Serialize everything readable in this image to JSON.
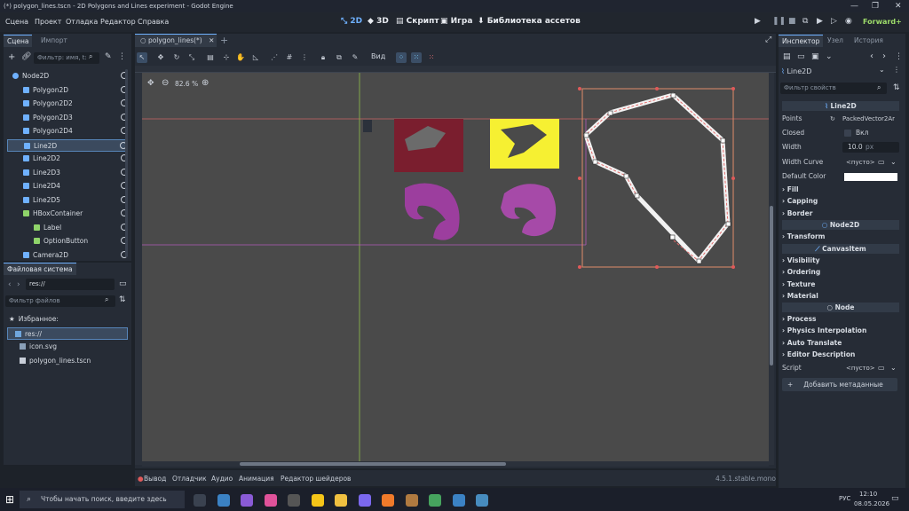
{
  "window": {
    "title": "(*) polygon_lines.tscn - 2D Polygons and Lines experiment - Godot Engine",
    "controls": [
      "—",
      "❐",
      "✕"
    ]
  },
  "menu": [
    "Сцена",
    "Проект",
    "Отладка",
    "Редактор",
    "Справка"
  ],
  "workspaces": [
    {
      "label": "2D",
      "active": true
    },
    {
      "label": "3D",
      "active": false
    },
    {
      "label": "Скрипт",
      "active": false
    },
    {
      "label": "Игра",
      "active": false
    },
    {
      "label": "Библиотека ассетов",
      "active": false
    }
  ],
  "renderer": "Forward+",
  "scene_dock": {
    "tabs": [
      "Сцена",
      "Импорт"
    ],
    "filter_placeholder": "Фильтр: имя, t:",
    "nodes": [
      {
        "label": "Node2D",
        "depth": 0,
        "icon": "node2d-icon"
      },
      {
        "label": "Polygon2D",
        "depth": 1,
        "icon": "polygon-icon"
      },
      {
        "label": "Polygon2D2",
        "depth": 1,
        "icon": "polygon-icon"
      },
      {
        "label": "Polygon2D3",
        "depth": 1,
        "icon": "polygon-icon"
      },
      {
        "label": "Polygon2D4",
        "depth": 1,
        "icon": "polygon-icon"
      },
      {
        "label": "Line2D",
        "depth": 1,
        "icon": "line-icon",
        "selected": true
      },
      {
        "label": "Line2D2",
        "depth": 1,
        "icon": "line-icon"
      },
      {
        "label": "Line2D3",
        "depth": 1,
        "icon": "line-icon"
      },
      {
        "label": "Line2D4",
        "depth": 1,
        "icon": "line-icon"
      },
      {
        "label": "Line2D5",
        "depth": 1,
        "icon": "line-icon"
      },
      {
        "label": "HBoxContainer",
        "depth": 1,
        "icon": "hbox-icon"
      },
      {
        "label": "Label",
        "depth": 2,
        "icon": "label-icon"
      },
      {
        "label": "OptionButton",
        "depth": 2,
        "icon": "option-icon"
      },
      {
        "label": "Camera2D",
        "depth": 1,
        "icon": "camera-icon"
      }
    ]
  },
  "filesystem": {
    "tab": "Файловая система",
    "path": "res://",
    "filter_placeholder": "Фильтр файлов",
    "items": [
      {
        "label": "Избранное:",
        "icon": "star-icon"
      },
      {
        "label": "res://",
        "icon": "folder-icon",
        "selected": true
      },
      {
        "label": "icon.svg",
        "icon": "file-icon"
      },
      {
        "label": "polygon_lines.tscn",
        "icon": "scene-icon"
      }
    ]
  },
  "editor": {
    "scene_tab": "polygon_lines(*)",
    "view_label": "Вид",
    "zoom": "82.6 %"
  },
  "inspector": {
    "tabs": [
      "Инспектор",
      "Узел",
      "История"
    ],
    "node": "Line2D",
    "filter_placeholder": "Фильтр свойств",
    "class_header": "Line2D",
    "props": [
      {
        "name": "Points",
        "value": "PackedVector2Ar"
      },
      {
        "name": "Closed",
        "value": "Вкл"
      },
      {
        "name": "Width",
        "value": "10.0",
        "unit": "px"
      },
      {
        "name": "Width Curve",
        "value": "<пусто>"
      },
      {
        "name": "Default Color",
        "value": ""
      }
    ],
    "sections_line2d": [
      "Fill",
      "Capping",
      "Border"
    ],
    "node2d_header": "Node2D",
    "sections_node2d": [
      "Transform"
    ],
    "canvasitem_header": "CanvasItem",
    "sections_canvasitem": [
      "Visibility",
      "Ordering",
      "Texture",
      "Material"
    ],
    "node_header": "Node",
    "sections_node": [
      "Process",
      "Physics Interpolation",
      "Auto Translate",
      "Editor Description"
    ],
    "script_label": "Script",
    "script_value": "<пусто>",
    "add_metadata": "Добавить метаданные"
  },
  "bottom_panel": {
    "tabs": [
      "Вывод",
      "Отладчик",
      "Аудио",
      "Анимация",
      "Редактор шейдеров"
    ],
    "version": "4.5.1.stable.mono"
  },
  "taskbar": {
    "search_placeholder": "Чтобы начать поиск, введите здесь запрос",
    "lang": "РУС",
    "time": "12:10",
    "date": "08.05.2026"
  },
  "colors": {
    "accent": "#6fb1ff",
    "canvas_bg": "#4a4a4a",
    "polygon_red": "#7a1e2e",
    "polygon_yellow": "#f6f032",
    "polygon_purple": "#a64aa8"
  }
}
